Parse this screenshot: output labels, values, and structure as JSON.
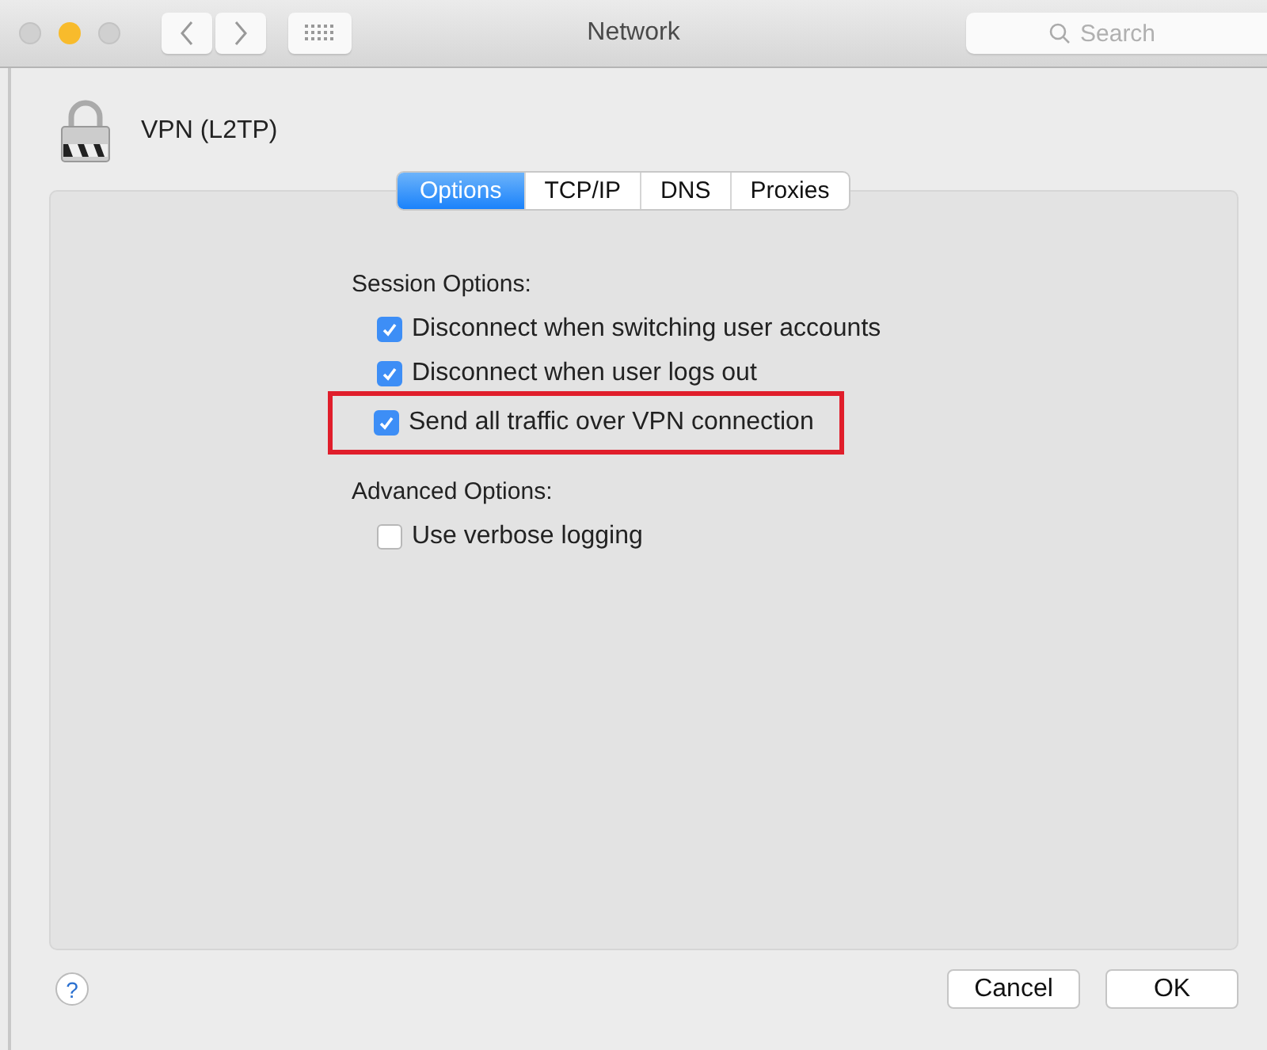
{
  "window": {
    "title": "Network"
  },
  "search": {
    "placeholder": "Search"
  },
  "service": {
    "name": "VPN (L2TP)"
  },
  "tabs": [
    {
      "label": "Options",
      "selected": true
    },
    {
      "label": "TCP/IP",
      "selected": false
    },
    {
      "label": "DNS",
      "selected": false
    },
    {
      "label": "Proxies",
      "selected": false
    }
  ],
  "sections": [
    {
      "title": "Session Options:",
      "options": [
        {
          "label": "Disconnect when switching user accounts",
          "checked": true,
          "highlighted": false
        },
        {
          "label": "Disconnect when user logs out",
          "checked": true,
          "highlighted": false
        },
        {
          "label": "Send all traffic over VPN connection",
          "checked": true,
          "highlighted": true
        }
      ]
    },
    {
      "title": "Advanced Options:",
      "options": [
        {
          "label": "Use verbose logging",
          "checked": false,
          "highlighted": false
        }
      ]
    }
  ],
  "help": "?",
  "buttons": [
    "Cancel",
    "OK"
  ]
}
